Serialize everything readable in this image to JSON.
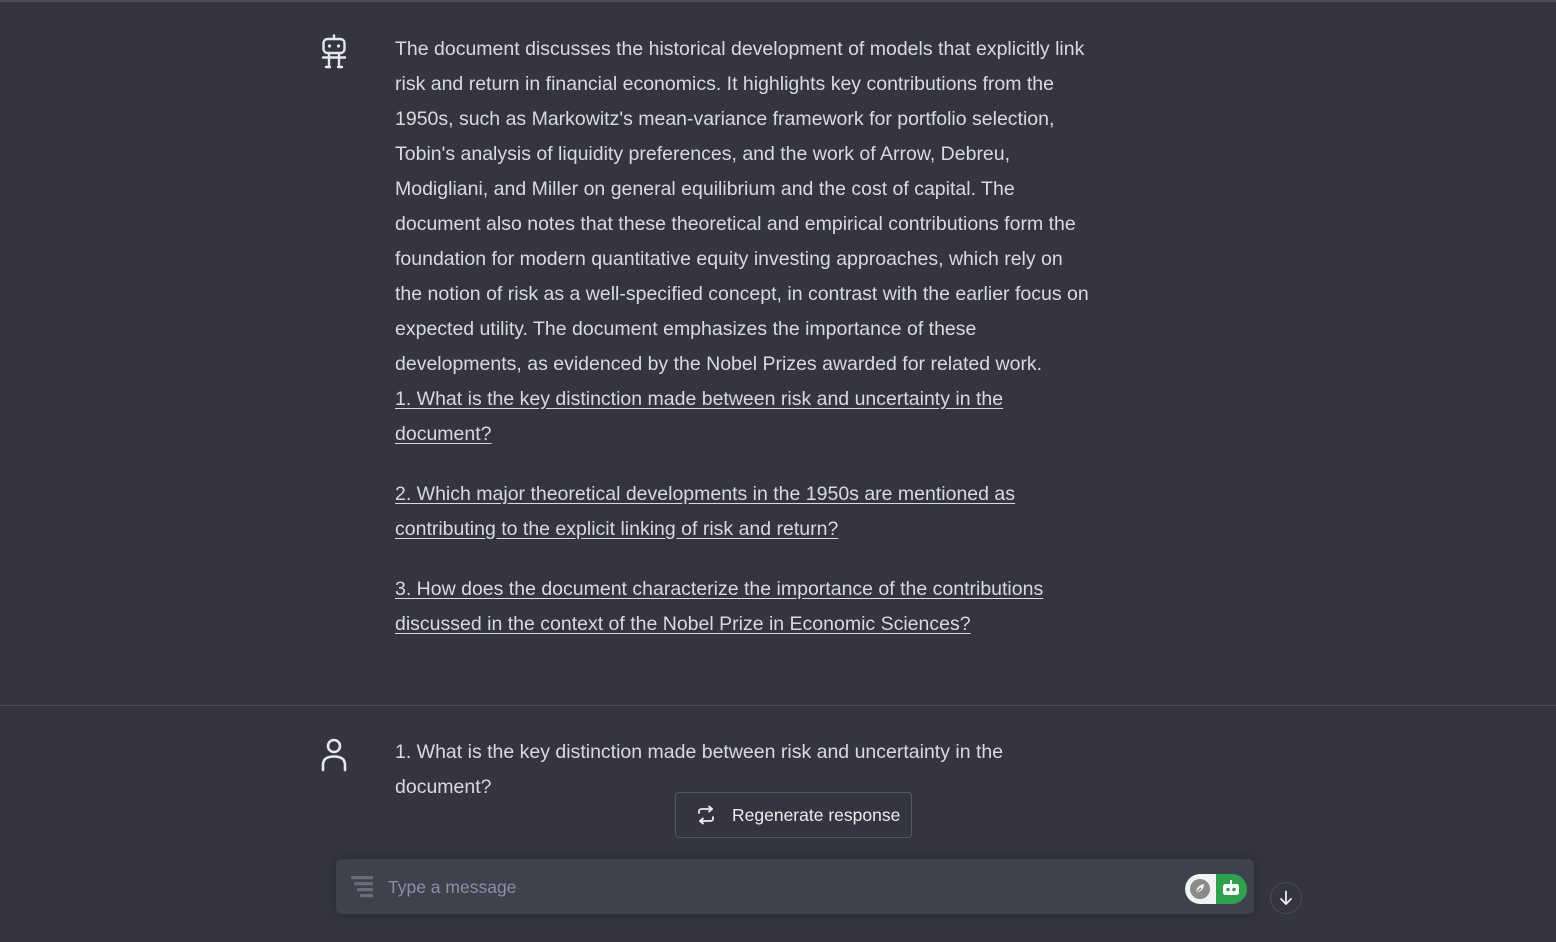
{
  "conversation": {
    "assistant_message": {
      "avatar_icon": "robot-icon",
      "text": "The document discusses the historical development of models that explicitly link risk and return in financial economics. It highlights key contributions from the 1950s, such as Markowitz's mean-variance framework for portfolio selection, Tobin's analysis of liquidity preferences, and the work of Arrow, Debreu, Modigliani, and Miller on general equilibrium and the cost of capital. The document also notes that these theoretical and empirical contributions form the foundation for modern quantitative equity investing approaches, which rely on the notion of risk as a well-specified concept, in contrast with the earlier focus on expected utility. The document emphasizes the importance of these developments, as evidenced by the Nobel Prizes awarded for related work.",
      "followups": [
        "1. What is the key distinction made between risk and uncertainty in the document? ",
        "2. Which major theoretical developments in the 1950s are mentioned as contributing to the explicit linking of risk and return? ",
        "3. How does the document characterize the importance of the contributions discussed in the context of the Nobel Prize in Economic Sciences? "
      ]
    },
    "user_message": {
      "avatar_icon": "user-icon",
      "text": "1. What is the key distinction made between risk and uncertainty in the document?"
    }
  },
  "regenerate": {
    "label": "Regenerate response",
    "icon": "refresh-icon"
  },
  "composer": {
    "placeholder": "Type a message",
    "value": "",
    "prompt_icon": "prompt-library-icon",
    "extension_icons": [
      "leaf-icon",
      "robot-icon"
    ],
    "extension_color": "#2fa14f"
  },
  "scroll_button": {
    "icon": "arrow-down-icon"
  },
  "theme": {
    "background": "#343541",
    "input_background": "#40414f",
    "text": "#d9dadf"
  }
}
